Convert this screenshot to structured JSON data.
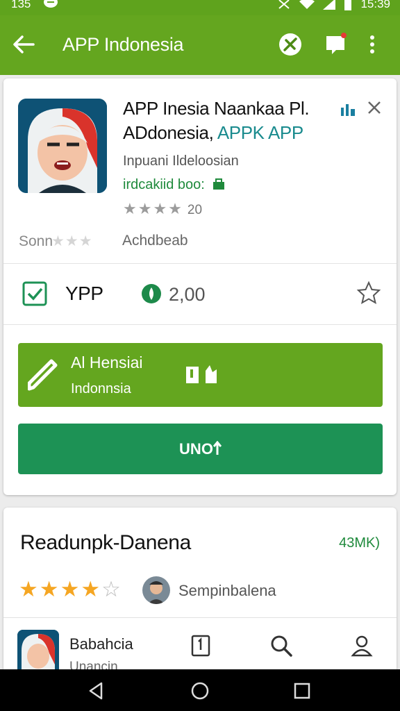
{
  "status_bar": {
    "time_left": "135",
    "time_right": "15:39"
  },
  "app_bar": {
    "title": "APP Indonesia"
  },
  "app": {
    "title_line1": "APP Inesia Naankaa Pl.",
    "title_line2_a": "ADdonesia, ",
    "title_line2_b": "APPK APP",
    "developer": "Inpuani Ildeloosian",
    "green_text": "irdcakiid boo:",
    "rating_count": "20",
    "meta_left": "Sonn",
    "meta_right": "Achdbeab"
  },
  "stats": {
    "ypp_label": "YPP",
    "downloads": "2,00"
  },
  "buttons": {
    "install_line1": "Al Hensiai",
    "install_line2": "Indonnsia",
    "open_label": "UNO"
  },
  "review": {
    "title": "Readunpk-Danena",
    "size": "43MK)",
    "rating": 4,
    "user": "Sempinbalena"
  },
  "bottom": {
    "app_name": "Babahcia",
    "app_sub": "Unancin"
  },
  "colors": {
    "green": "#64a61f",
    "dark_green": "#1d9255",
    "star": "#f5a623"
  }
}
